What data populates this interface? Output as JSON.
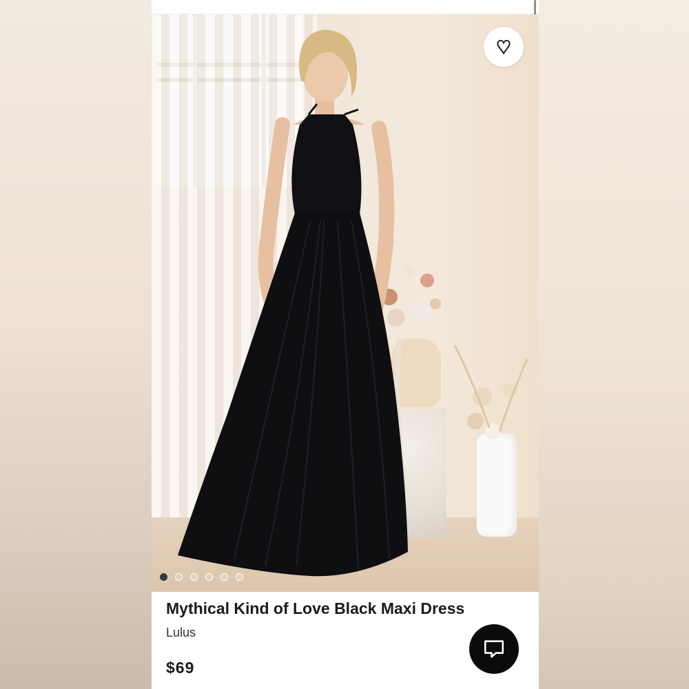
{
  "listing": {
    "title": "Mythical Kind of Love Black Maxi Dress",
    "brand": "Lulus",
    "price": "$69"
  },
  "gallery": {
    "image_count": 6,
    "active_index": 0
  },
  "icons": {
    "favorite": "heart-icon",
    "chat": "chat-bubble-icon"
  },
  "colors": {
    "dress": "#0f0f12",
    "active_dot": "#2f3a46",
    "chat_button": "#0b0b0b"
  }
}
